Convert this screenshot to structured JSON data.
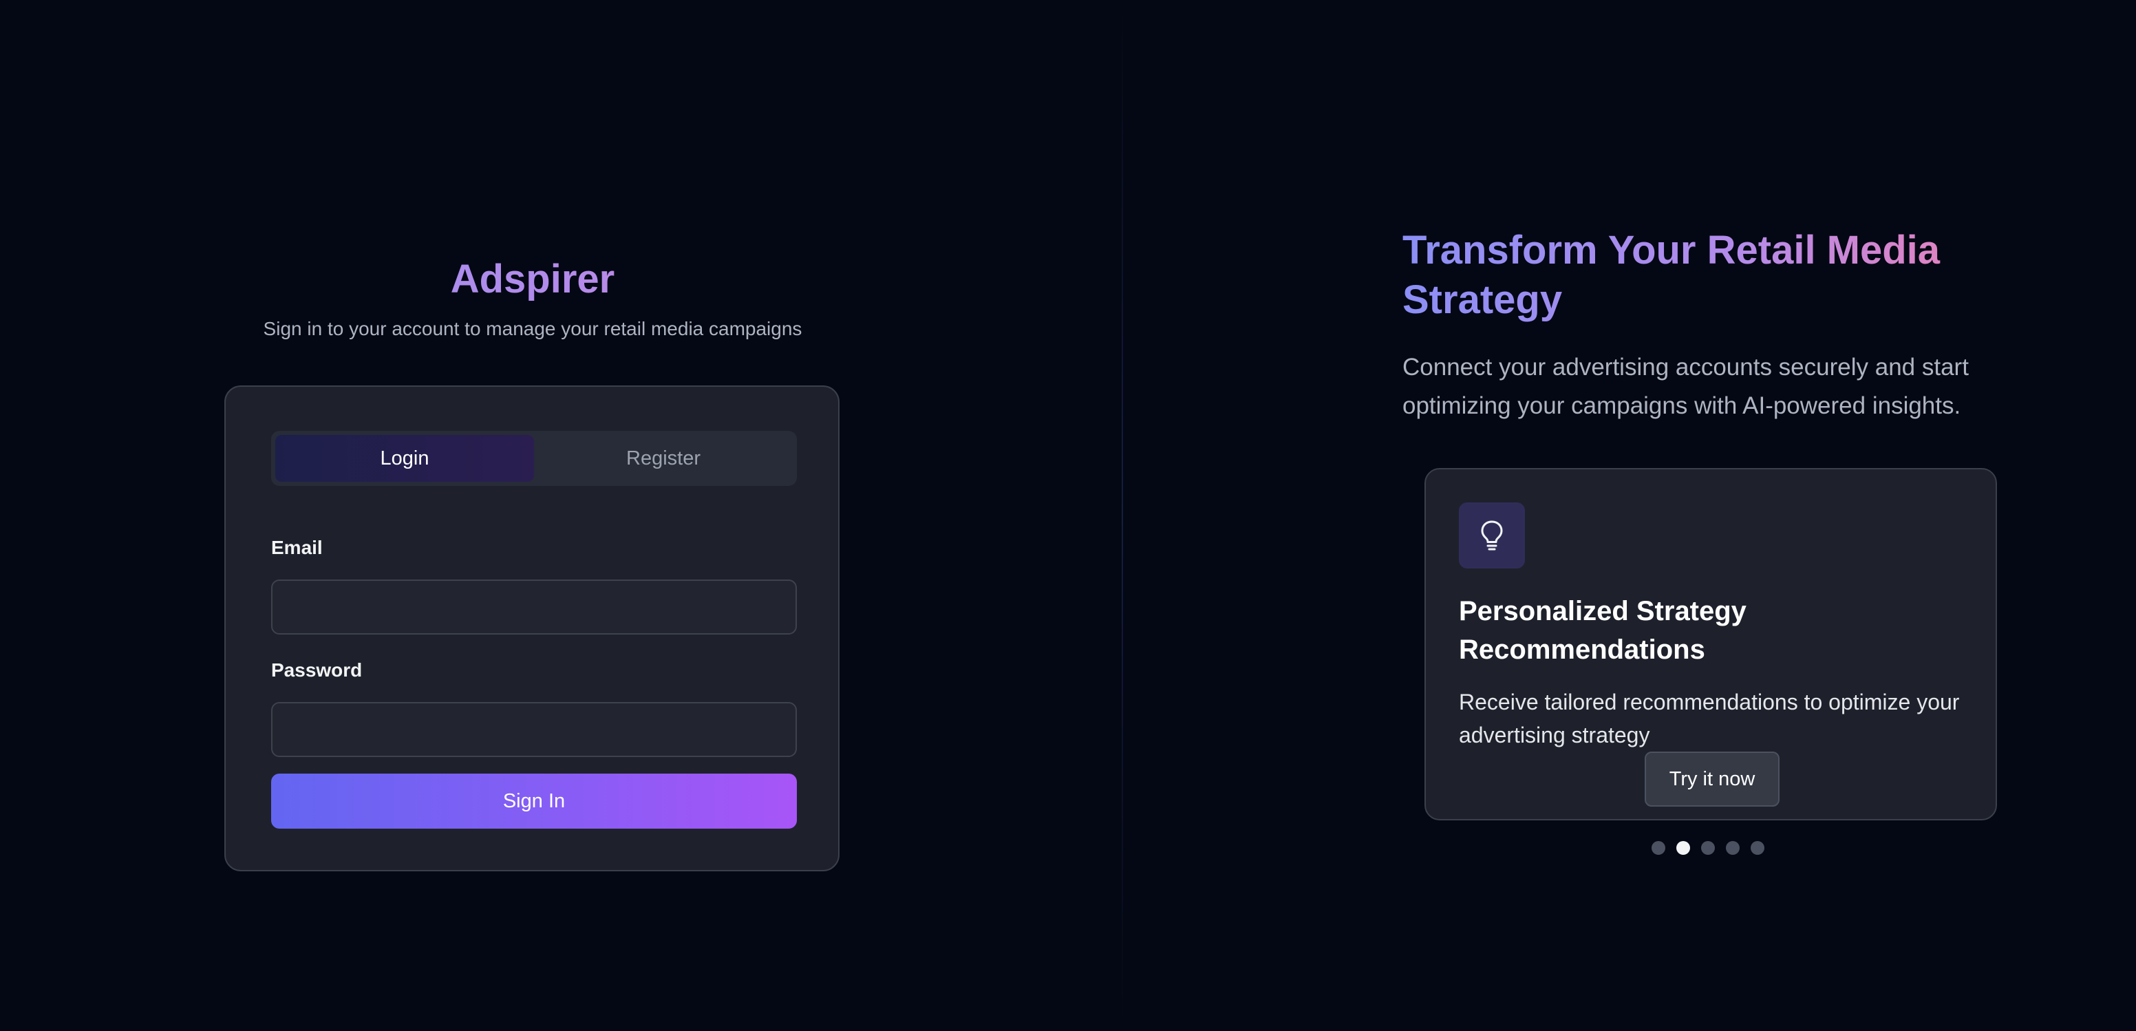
{
  "login": {
    "brand": "Adspirer",
    "subtitle": "Sign in to your account to manage your retail media campaigns",
    "tabs": [
      {
        "label": "Login",
        "active": true
      },
      {
        "label": "Register",
        "active": false
      }
    ],
    "email_label": "Email",
    "email_value": "",
    "password_label": "Password",
    "password_value": "",
    "submit_label": "Sign In"
  },
  "hero": {
    "title": "Transform Your Retail Media Strategy",
    "description": "Connect your advertising accounts securely and start optimizing your campaigns with AI-powered insights."
  },
  "carousel": {
    "icon": "lightbulb-icon",
    "title": "Personalized Strategy Recommendations",
    "description": "Receive tailored recommendations to optimize your advertising strategy",
    "cta_label": "Try it now",
    "slide_count": 5,
    "active_slide": 2
  },
  "colors": {
    "background": "#040814",
    "card": "#1e212b",
    "accent_start": "#6366f1",
    "accent_end": "#a855f7"
  }
}
